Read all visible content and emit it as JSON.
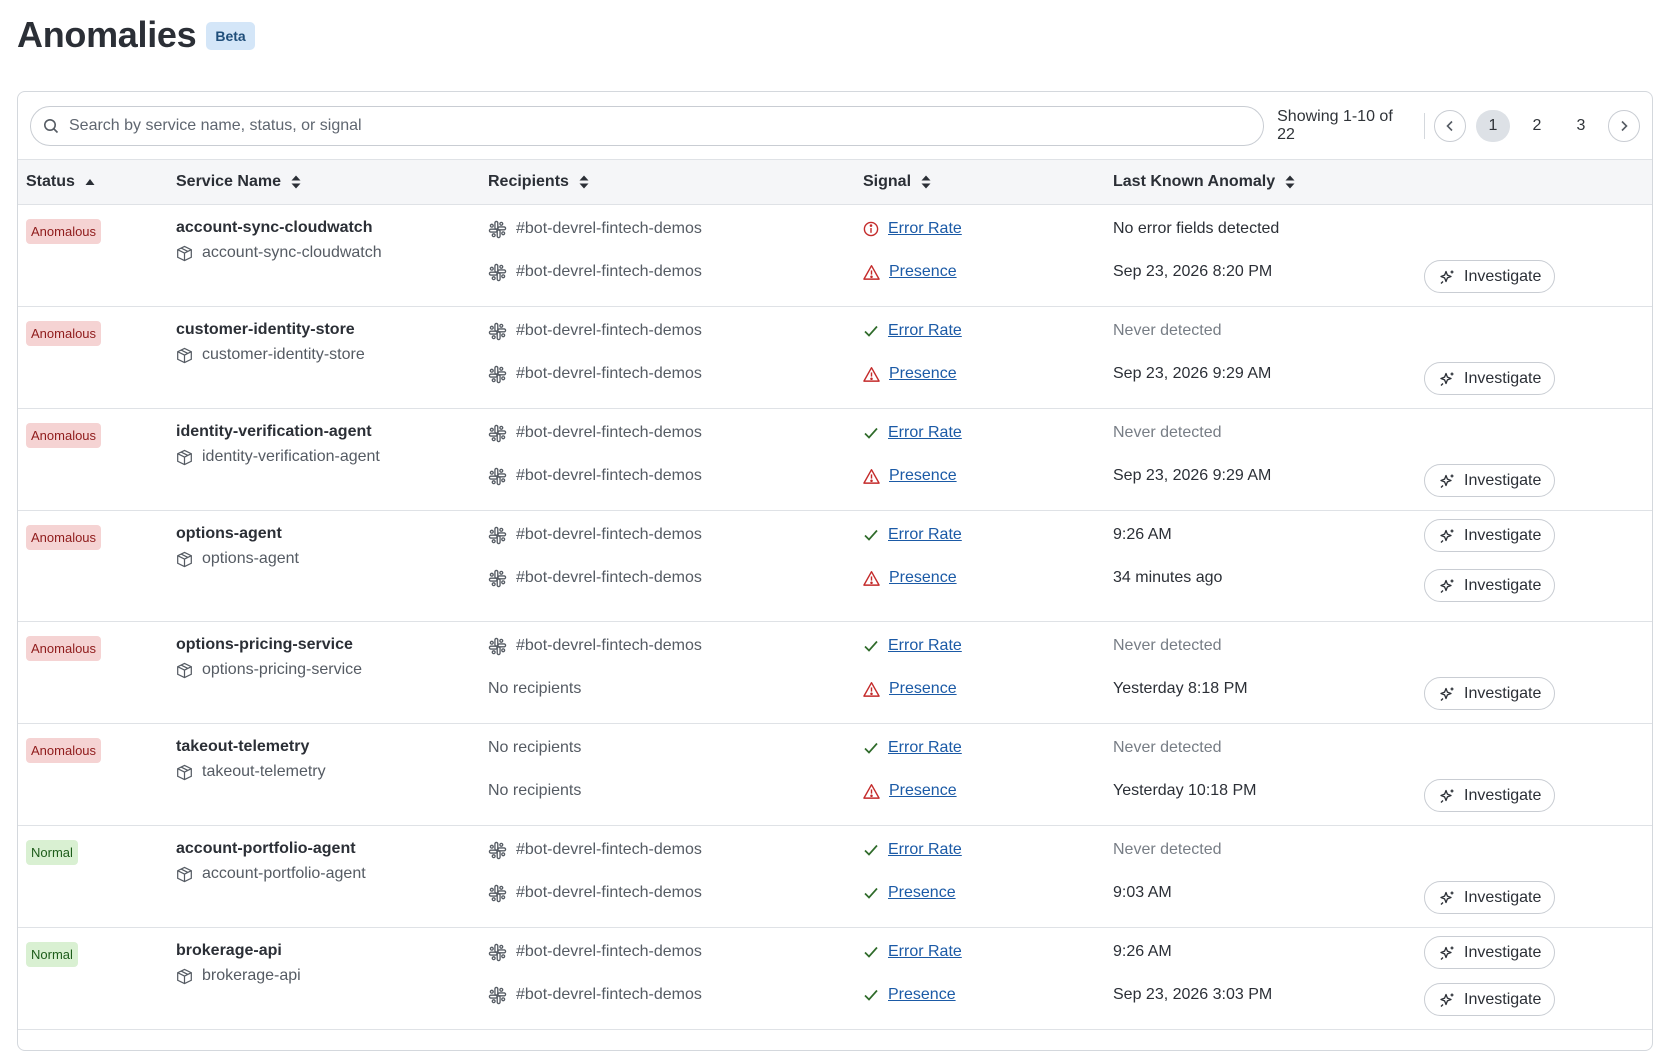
{
  "header": {
    "title": "Anomalies",
    "badge": "Beta"
  },
  "toolbar": {
    "search_placeholder": "Search by service name, status, or signal",
    "showing": "Showing 1-10 of 22",
    "pages": [
      "1",
      "2",
      "3"
    ],
    "current_page": "1"
  },
  "columns": {
    "status": "Status",
    "service": "Service Name",
    "recipients": "Recipients",
    "signal": "Signal",
    "last": "Last Known Anomaly"
  },
  "investigate_label": "Investigate",
  "icons": {
    "search": "search-icon",
    "prev": "chevron-left-icon",
    "next": "chevron-right-icon",
    "sort": "sort-icon",
    "slack": "slack-icon",
    "service": "cube-icon",
    "ok": "check-icon",
    "warning": "warning-triangle-icon",
    "info": "info-circle-icon",
    "investigate": "sparkle-icon"
  },
  "colors": {
    "anomalous_bg": "#f5d3d3",
    "anomalous_text": "#8f1b1b",
    "normal_bg": "#d9f0d2",
    "normal_text": "#1d5c1a",
    "link": "#1b5aa6",
    "warning": "#c42b2b",
    "ok": "#2f6b2a"
  },
  "rows": [
    {
      "status": "Anomalous",
      "service": "account-sync-cloudwatch",
      "service_sub": "account-sync-cloudwatch",
      "signals": [
        {
          "recipient": "#bot-devrel-fintech-demos",
          "icon": "info",
          "signal": "Error Rate",
          "last": "No error fields detected",
          "muted": false,
          "investigate": false
        },
        {
          "recipient": "#bot-devrel-fintech-demos",
          "icon": "warning",
          "signal": "Presence",
          "last": "Sep 23, 2026 8:20 PM",
          "muted": false,
          "investigate": true
        }
      ]
    },
    {
      "status": "Anomalous",
      "service": "customer-identity-store",
      "service_sub": "customer-identity-store",
      "signals": [
        {
          "recipient": "#bot-devrel-fintech-demos",
          "icon": "ok",
          "signal": "Error Rate",
          "last": "Never detected",
          "muted": true,
          "investigate": false
        },
        {
          "recipient": "#bot-devrel-fintech-demos",
          "icon": "warning",
          "signal": "Presence",
          "last": "Sep 23, 2026 9:29 AM",
          "muted": false,
          "investigate": true
        }
      ]
    },
    {
      "status": "Anomalous",
      "service": "identity-verification-agent",
      "service_sub": "identity-verification-agent",
      "signals": [
        {
          "recipient": "#bot-devrel-fintech-demos",
          "icon": "ok",
          "signal": "Error Rate",
          "last": "Never detected",
          "muted": true,
          "investigate": false
        },
        {
          "recipient": "#bot-devrel-fintech-demos",
          "icon": "warning",
          "signal": "Presence",
          "last": "Sep 23, 2026 9:29 AM",
          "muted": false,
          "investigate": true
        }
      ]
    },
    {
      "status": "Anomalous",
      "service": "options-agent",
      "service_sub": "options-agent",
      "signals": [
        {
          "recipient": "#bot-devrel-fintech-demos",
          "icon": "ok",
          "signal": "Error Rate",
          "last": "9:26 AM",
          "muted": false,
          "investigate": true
        },
        {
          "recipient": "#bot-devrel-fintech-demos",
          "icon": "warning",
          "signal": "Presence",
          "last": "34 minutes ago",
          "muted": false,
          "investigate": true
        }
      ]
    },
    {
      "status": "Anomalous",
      "service": "options-pricing-service",
      "service_sub": "options-pricing-service",
      "signals": [
        {
          "recipient": "#bot-devrel-fintech-demos",
          "icon": "ok",
          "signal": "Error Rate",
          "last": "Never detected",
          "muted": true,
          "investigate": false
        },
        {
          "recipient": "No recipients",
          "icon": "warning",
          "signal": "Presence",
          "last": "Yesterday 8:18 PM",
          "muted": false,
          "investigate": true
        }
      ]
    },
    {
      "status": "Anomalous",
      "service": "takeout-telemetry",
      "service_sub": "takeout-telemetry",
      "signals": [
        {
          "recipient": "No recipients",
          "icon": "ok",
          "signal": "Error Rate",
          "last": "Never detected",
          "muted": true,
          "investigate": false
        },
        {
          "recipient": "No recipients",
          "icon": "warning",
          "signal": "Presence",
          "last": "Yesterday 10:18 PM",
          "muted": false,
          "investigate": true
        }
      ]
    },
    {
      "status": "Normal",
      "service": "account-portfolio-agent",
      "service_sub": "account-portfolio-agent",
      "signals": [
        {
          "recipient": "#bot-devrel-fintech-demos",
          "icon": "ok",
          "signal": "Error Rate",
          "last": "Never detected",
          "muted": true,
          "investigate": false
        },
        {
          "recipient": "#bot-devrel-fintech-demos",
          "icon": "ok",
          "signal": "Presence",
          "last": "9:03 AM",
          "muted": false,
          "investigate": true
        }
      ]
    },
    {
      "status": "Normal",
      "service": "brokerage-api",
      "service_sub": "brokerage-api",
      "signals": [
        {
          "recipient": "#bot-devrel-fintech-demos",
          "icon": "ok",
          "signal": "Error Rate",
          "last": "9:26 AM",
          "muted": false,
          "investigate": true
        },
        {
          "recipient": "#bot-devrel-fintech-demos",
          "icon": "ok",
          "signal": "Presence",
          "last": "Sep 23, 2026 3:03 PM",
          "muted": false,
          "investigate": true
        }
      ]
    }
  ]
}
